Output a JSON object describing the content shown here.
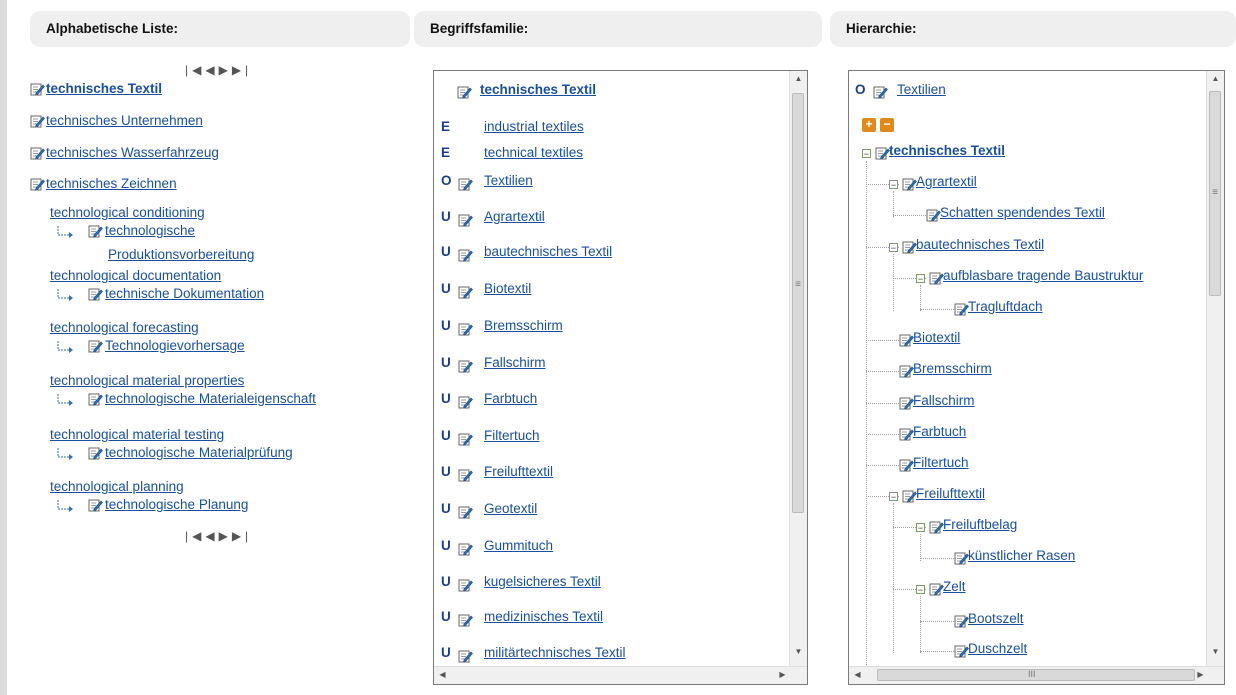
{
  "headers": {
    "alphabetical": "Alphabetische Liste:",
    "family": "Begriffsfamilie:",
    "hierarchy": "Hierarchie:"
  },
  "alpha_list": {
    "main_items": [
      "technisches Textil",
      "technisches Unternehmen",
      "technisches Wasserfahrzeug",
      "technisches Zeichnen"
    ],
    "pairs": [
      {
        "en": "technological conditioning",
        "de": "technologische Produktionsvorbereitung",
        "de_line1": "technologische",
        "de_line2": "Produktionsvorbereitung"
      },
      {
        "en": "technological documentation",
        "de": "technische Dokumentation"
      },
      {
        "en": "technological forecasting",
        "de": "Technologievorhersage"
      },
      {
        "en": "technological material properties",
        "de": "technologische Materialeigenschaft"
      },
      {
        "en": "technological material testing",
        "de": "technologische Materialprüfung"
      },
      {
        "en": "technological planning",
        "de": "technologische Planung"
      }
    ]
  },
  "family": {
    "head": "technisches Textil",
    "entries": [
      {
        "rel": "E",
        "label": "industrial textiles",
        "icon": false
      },
      {
        "rel": "E",
        "label": "technical textiles",
        "icon": false
      },
      {
        "rel": "O",
        "label": "Textilien",
        "icon": true
      },
      {
        "rel": "U",
        "label": "Agrartextil",
        "icon": true
      },
      {
        "rel": "U",
        "label": "bautechnisches Textil",
        "icon": true
      },
      {
        "rel": "U",
        "label": "Biotextil",
        "icon": true
      },
      {
        "rel": "U",
        "label": "Bremsschirm",
        "icon": true
      },
      {
        "rel": "U",
        "label": "Fallschirm",
        "icon": true
      },
      {
        "rel": "U",
        "label": "Farbtuch",
        "icon": true
      },
      {
        "rel": "U",
        "label": "Filtertuch",
        "icon": true
      },
      {
        "rel": "U",
        "label": "Freilufttextil",
        "icon": true
      },
      {
        "rel": "U",
        "label": "Geotextil",
        "icon": true
      },
      {
        "rel": "U",
        "label": "Gummituch",
        "icon": true
      },
      {
        "rel": "U",
        "label": "kugelsicheres Textil",
        "icon": true
      },
      {
        "rel": "U",
        "label": "medizinisches Textil",
        "icon": true
      },
      {
        "rel": "U",
        "label": "militärtechnisches Textil",
        "icon": true
      }
    ]
  },
  "hierarchy": {
    "root_rel": "O",
    "root": "Textilien",
    "expand_label": "+",
    "collapse_label": "−",
    "nodes": [
      "technisches Textil",
      "Agrartextil",
      "Schatten spendendes Textil",
      "bautechnisches Textil",
      "aufblasbare tragende Baustruktur",
      "Tragluftdach",
      "Biotextil",
      "Bremsschirm",
      "Fallschirm",
      "Farbtuch",
      "Filtertuch",
      "Freilufttextil",
      "Freiluftbelag",
      "künstlicher Rasen",
      "Zelt",
      "Bootszelt",
      "Duschzelt"
    ]
  },
  "scroll_glyphs": {
    "up": "▲",
    "down": "▼",
    "left": "◀",
    "right": "▶",
    "grip": "≡",
    "hgrip": "III"
  },
  "pager_glyphs": {
    "first": "|◀",
    "prev": "◀",
    "next": "▶",
    "last": "▶|"
  },
  "colors": {
    "link": "#1a4fa0",
    "header_bg": "#efefef",
    "orange_button": "#e08a1e"
  }
}
